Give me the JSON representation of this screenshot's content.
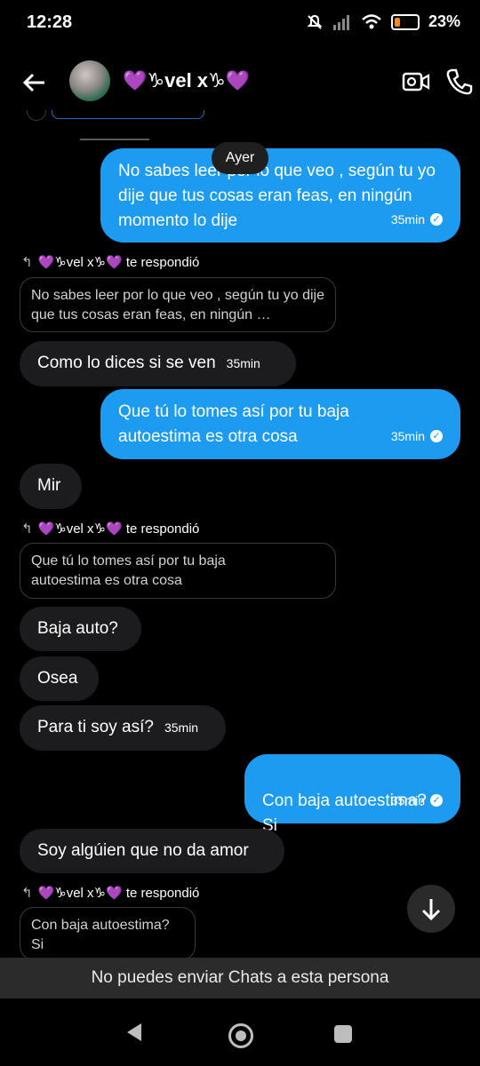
{
  "status_bar": {
    "time": "12:28",
    "battery_pct": "23%",
    "battery_level": 0.23,
    "icons": [
      "mute-icon",
      "signal-icon",
      "wifi-icon",
      "battery-icon"
    ]
  },
  "header": {
    "title": "💜♑vel x♑💜",
    "back_icon": "back-arrow-icon",
    "video_icon": "video-call-icon",
    "call_icon": "phone-icon"
  },
  "day_divider": "Ayer",
  "messages": [
    {
      "text": "No sabes leer por lo que veo , según tu yo dije que tus cosas eran feas, en ningún momento lo dije",
      "time": "35min"
    },
    {
      "reply_label": "💜♑vel x♑💜 te respondió",
      "quote": "No sabes leer por lo que veo , según tu yo dije que tus cosas eran feas, en ningún …"
    },
    {
      "text": "Como lo dices si se ven",
      "time": "35min"
    },
    {
      "text": "Que tú lo tomes así por tu baja autoestima es otra cosa",
      "time": "35min"
    },
    {
      "text": "Mir"
    },
    {
      "reply_label": "💜♑vel x♑💜 te respondió",
      "quote": "Que tú lo tomes así por tu baja autoestima es otra cosa"
    },
    {
      "text": "Baja auto?"
    },
    {
      "text": "Osea"
    },
    {
      "text": "Para ti soy así?",
      "time": "35min"
    },
    {
      "text": "Con baja autoestima?\nSi",
      "time": "35min"
    },
    {
      "text": "Soy algúien que no da amor"
    },
    {
      "reply_label": "💜♑vel x♑💜 te respondió",
      "quote": "Con baja autoestima?\nSi"
    }
  ],
  "scroll_down_icon": "arrow-down-icon",
  "notice": "No puedes enviar Chats a esta persona",
  "nav": {
    "back": "nav-back-icon",
    "home": "nav-home-icon",
    "recents": "nav-recents-icon"
  },
  "colors": {
    "sent_bubble": "#1d9bf0",
    "received_bubble": "#1c1c1e",
    "background": "#000000",
    "notice_bar": "#2b2b2b"
  }
}
